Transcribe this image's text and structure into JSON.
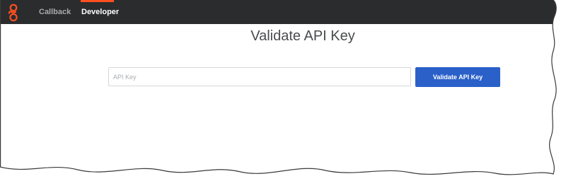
{
  "nav": {
    "logo_icon": "genesys-logo-icon",
    "items": [
      {
        "label": "Callback",
        "active": false
      },
      {
        "label": "Developer",
        "active": true
      }
    ],
    "accent_color": "#ff4f1f",
    "background_color": "#2b2c2e"
  },
  "main": {
    "title": "Validate API Key",
    "input": {
      "value": "",
      "placeholder": "API Key"
    },
    "validate_button_label": "Validate API Key",
    "button_color": "#2a60c8"
  }
}
